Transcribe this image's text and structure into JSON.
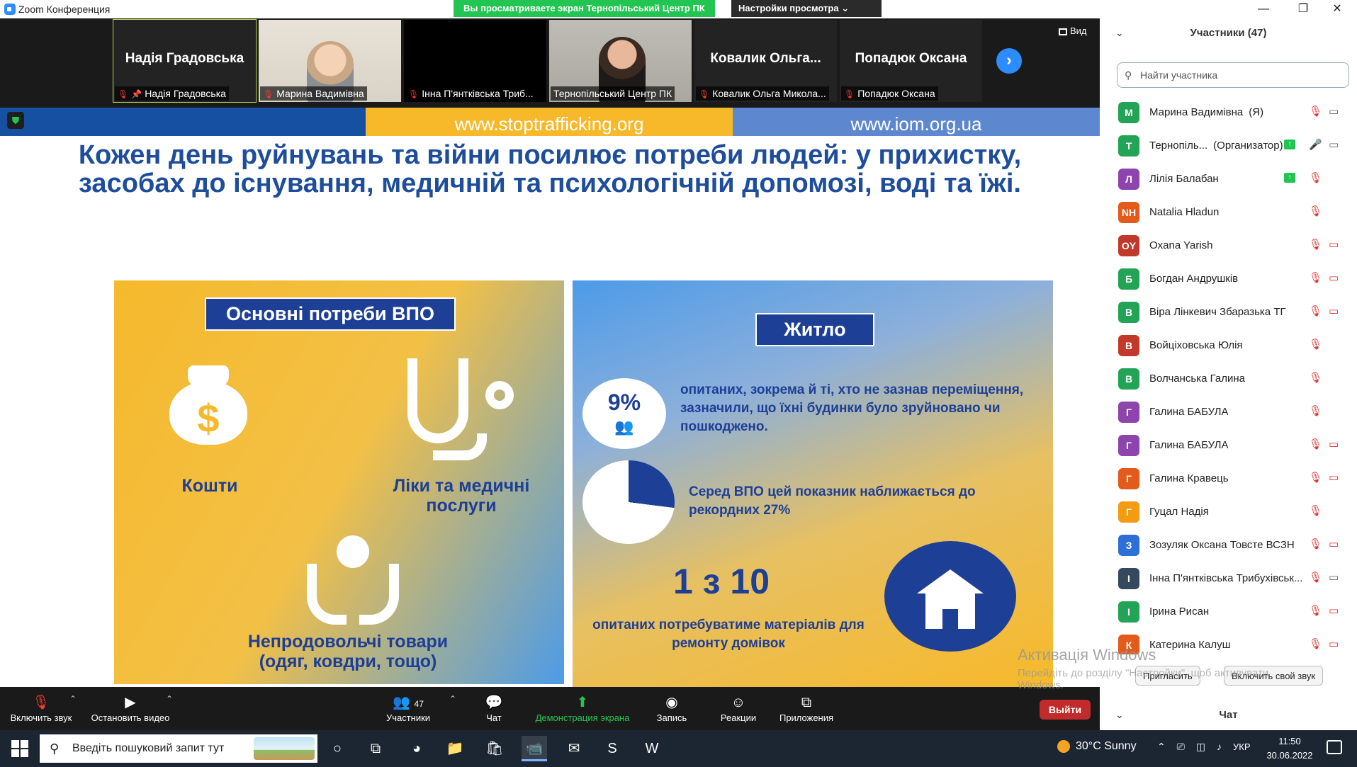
{
  "window": {
    "title": "Zoom Конференция",
    "share_banner": "Вы просматриваете экран Тернопільський Центр ПК",
    "view_settings": "Настройки просмотра",
    "view_button": "Вид"
  },
  "tiles": [
    {
      "big_name": "Надія Градовська",
      "label": "Надія Градовська",
      "muted": true,
      "pinned": true,
      "type": "name",
      "active": true
    },
    {
      "big_name": "",
      "label": "Марина Вадимівна",
      "muted": true,
      "type": "photo1"
    },
    {
      "big_name": "",
      "label": "Інна П'янтківська Триб...",
      "muted": true,
      "type": "black"
    },
    {
      "big_name": "",
      "label": "Тернопільський Центр ПК",
      "muted": false,
      "type": "photo2"
    },
    {
      "big_name": "Ковалик Ольга...",
      "label": "Ковалик Ольга Микола...",
      "muted": true,
      "type": "name"
    },
    {
      "big_name": "Попадюк Оксана",
      "label": "Попадюк Оксана",
      "muted": true,
      "type": "name"
    }
  ],
  "slide": {
    "urls": [
      "",
      "www.stoptrafficking.org",
      "www.iom.org.ua"
    ],
    "headline_line1": "Кожен день руйнувань та війни посилює потреби людей: у прихистку,",
    "headline_line2": "засобах до існування, медичній та психологічній допомозі, воді та їжі.",
    "left": {
      "title": "Основні потреби ВПО",
      "money": "Кошти",
      "medicine": "Ліки та медичні послуги",
      "nonfood": "Непродовольчі товари (одяг, ковдри, тощо)"
    },
    "right": {
      "title": "Житло",
      "pct": "9%",
      "pct_text": "опитаних, зокрема й ті, хто не зазнав переміщення, зазначили, що їхні будинки було зруйновано чи пошкоджено.",
      "idp_text": "Серед ВПО цей показник наближається до рекордних 27%",
      "ratio": "1 з 10",
      "ratio_text": "опитаних потребуватиме матеріалів для ремонту домівок"
    }
  },
  "toolbar": {
    "unmute": "Включить звук",
    "stop_video": "Остановить видео",
    "participants": "Участники",
    "participants_count": "47",
    "chat": "Чат",
    "share": "Демонстрация экрана",
    "record": "Запись",
    "reactions": "Реакции",
    "apps": "Приложения",
    "exit": "Выйти"
  },
  "panel": {
    "title": "Участники (47)",
    "search_placeholder": "Найти участника",
    "invite": "Пригласить",
    "unmute_all": "Включить свой звук",
    "chat_title": "Чат",
    "participants": [
      {
        "initial": "М",
        "color": "#23a356",
        "name": "Марина Вадимівна",
        "role": "(Я)",
        "mic": "muted",
        "cam": "on",
        "share": false
      },
      {
        "initial": "Т",
        "color": "#23a356",
        "name": "Тернопіль...",
        "role": "(Организатор)",
        "mic": "on",
        "cam": "on",
        "share": true
      },
      {
        "initial": "Л",
        "color": "#8e44ad",
        "name": "Лілія Балабан",
        "role": "",
        "mic": "muted",
        "cam": "",
        "share": true
      },
      {
        "initial": "NH",
        "color": "#e35a1b",
        "name": "Natalia Hladun",
        "role": "",
        "mic": "muted",
        "cam": "",
        "share": false
      },
      {
        "initial": "OY",
        "color": "#c0392b",
        "name": "Oxana  Yarish",
        "role": "",
        "mic": "muted",
        "cam": "off",
        "share": false
      },
      {
        "initial": "Б",
        "color": "#23a356",
        "name": "Богдан Андрушків",
        "role": "",
        "mic": "muted",
        "cam": "off",
        "share": false
      },
      {
        "initial": "В",
        "color": "#23a356",
        "name": "Віра Лінкевич Збаразька ТГ",
        "role": "",
        "mic": "muted",
        "cam": "off",
        "share": false
      },
      {
        "initial": "В",
        "color": "#c0392b",
        "name": "Войціховська Юлія",
        "role": "",
        "mic": "muted",
        "cam": "",
        "share": false
      },
      {
        "initial": "В",
        "color": "#23a356",
        "name": "Волчанська Галина",
        "role": "",
        "mic": "muted",
        "cam": "",
        "share": false
      },
      {
        "initial": "Г",
        "color": "#8e44ad",
        "name": "Галина БАБУЛА",
        "role": "",
        "mic": "muted",
        "cam": "",
        "share": false
      },
      {
        "initial": "Г",
        "color": "#8e44ad",
        "name": "Галина БАБУЛА",
        "role": "",
        "mic": "muted",
        "cam": "off",
        "share": false
      },
      {
        "initial": "Г",
        "color": "#e35a1b",
        "name": "Галина Кравець",
        "role": "",
        "mic": "muted",
        "cam": "off",
        "share": false
      },
      {
        "initial": "Г",
        "color": "#f39c12",
        "name": "Гуцал Надія",
        "role": "",
        "mic": "muted",
        "cam": "",
        "share": false
      },
      {
        "initial": "З",
        "color": "#2d6fd6",
        "name": "Зозуляк Оксана Товсте ВСЗН",
        "role": "",
        "mic": "muted",
        "cam": "off",
        "share": false
      },
      {
        "initial": "І",
        "color": "#34495e",
        "name": "Інна П'янтківська Трибухівськ...",
        "role": "",
        "mic": "muted",
        "cam": "on",
        "share": false
      },
      {
        "initial": "І",
        "color": "#23a356",
        "name": "Ірина Рисан",
        "role": "",
        "mic": "muted",
        "cam": "off",
        "share": false
      },
      {
        "initial": "К",
        "color": "#e35a1b",
        "name": "Катерина Калуш",
        "role": "",
        "mic": "muted",
        "cam": "off",
        "share": false
      }
    ]
  },
  "watermark": {
    "line1": "Активація Windows",
    "line2": "Перейдіть до розділу \"Настройки\", щоб активувати Windows."
  },
  "taskbar": {
    "search_placeholder": "Введіть пошуковий запит тут",
    "weather": "30°C  Sunny",
    "lang": "УКР",
    "time": "11:50",
    "date": "30.06.2022"
  }
}
